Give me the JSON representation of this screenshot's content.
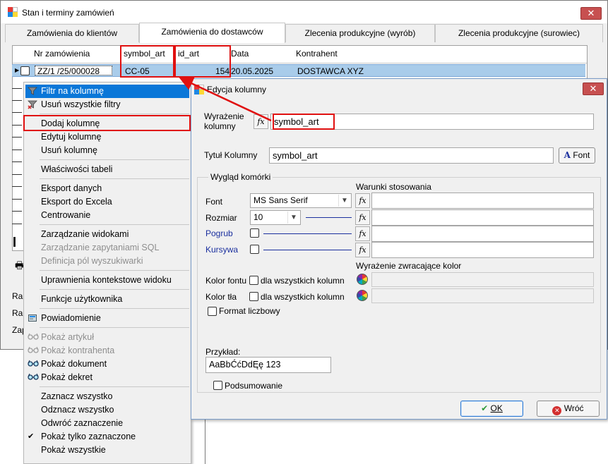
{
  "window": {
    "title": "Stan i terminy zamówień",
    "close_symbol": "✕"
  },
  "tabs": [
    {
      "label": "Zamówienia do klientów"
    },
    {
      "label": "Zamówienia do dostawców"
    },
    {
      "label": "Zlecenia produkcyjne (wyrób)"
    },
    {
      "label": "Zlecenia produkcyjne (surowiec)"
    }
  ],
  "grid": {
    "columns": [
      "Nr zamówienia",
      "symbol_art",
      "id_art",
      "Data",
      "Kontrahent"
    ],
    "row": {
      "nr": "ZZ/1  /25/000028",
      "symbol_art": "CC-05",
      "id_art": "154",
      "data": "20.05.2025",
      "kontrahent": "DOSTAWCA XYZ"
    },
    "side_labels": [
      "Ra",
      "Ra",
      "Zap"
    ]
  },
  "context_menu": {
    "items": [
      {
        "label": "Filtr na kolumnę",
        "icon": "funnel-icon"
      },
      {
        "label": "Usuń wszystkie filtry",
        "icon": "funnel-remove-icon"
      },
      {
        "label": "Dodaj kolumnę"
      },
      {
        "label": "Edytuj kolumnę"
      },
      {
        "label": "Usuń kolumnę"
      },
      {
        "label": "Właściwości tabeli"
      },
      {
        "label": "Eksport danych"
      },
      {
        "label": "Eksport do Excela"
      },
      {
        "label": "Centrowanie"
      },
      {
        "label": "Zarządzanie widokami"
      },
      {
        "label": "Zarządzanie zapytaniami SQL"
      },
      {
        "label": "Definicja pól wyszukiwarki"
      },
      {
        "label": "Uprawnienia kontekstowe widoku"
      },
      {
        "label": "Funkcje użytkownika"
      },
      {
        "label": "Powiadomienie",
        "icon": "notification-icon"
      },
      {
        "label": "Pokaż artykuł",
        "icon": "glasses-icon"
      },
      {
        "label": "Pokaż kontrahenta",
        "icon": "glasses-icon"
      },
      {
        "label": "Pokaż dokument",
        "icon": "glasses-icon"
      },
      {
        "label": "Pokaż dekret",
        "icon": "glasses-icon"
      },
      {
        "label": "Zaznacz wszystko"
      },
      {
        "label": "Odznacz wszystko"
      },
      {
        "label": "Odwróć zaznaczenie"
      },
      {
        "label": "Pokaż tylko zaznaczone",
        "icon": "check-icon"
      },
      {
        "label": "Pokaż wszystkie"
      }
    ]
  },
  "dialog": {
    "title": "Edycja kolumny",
    "close_symbol": "✕",
    "expression_label": "Wyrażenie kolumny",
    "expression_value": "symbol_art",
    "title_label": "Tytuł Kolumny",
    "title_value": "symbol_art",
    "font_button": "Font",
    "group_label": "Wygląd komórki",
    "conditions_label": "Warunki stosowania",
    "font_label": "Font",
    "font_value": "MS Sans Serif",
    "size_label": "Rozmiar",
    "size_value": "10",
    "bold_label": "Pogrub",
    "italic_label": "Kursywa",
    "color_expr_label": "Wyrażenie zwracające kolor",
    "font_color_label": "Kolor fontu",
    "bg_color_label": "Kolor tła",
    "all_columns_label": "dla wszystkich kolumn",
    "number_format_label": "Format liczbowy",
    "example_label": "Przykład:",
    "example_value": "AaBbĆćDdĘę 123",
    "summary_label": "Podsumowanie",
    "ok_label": "OK",
    "cancel_label": "Wróć",
    "fx_symbol": "fx",
    "accent_red": "#e01010"
  }
}
